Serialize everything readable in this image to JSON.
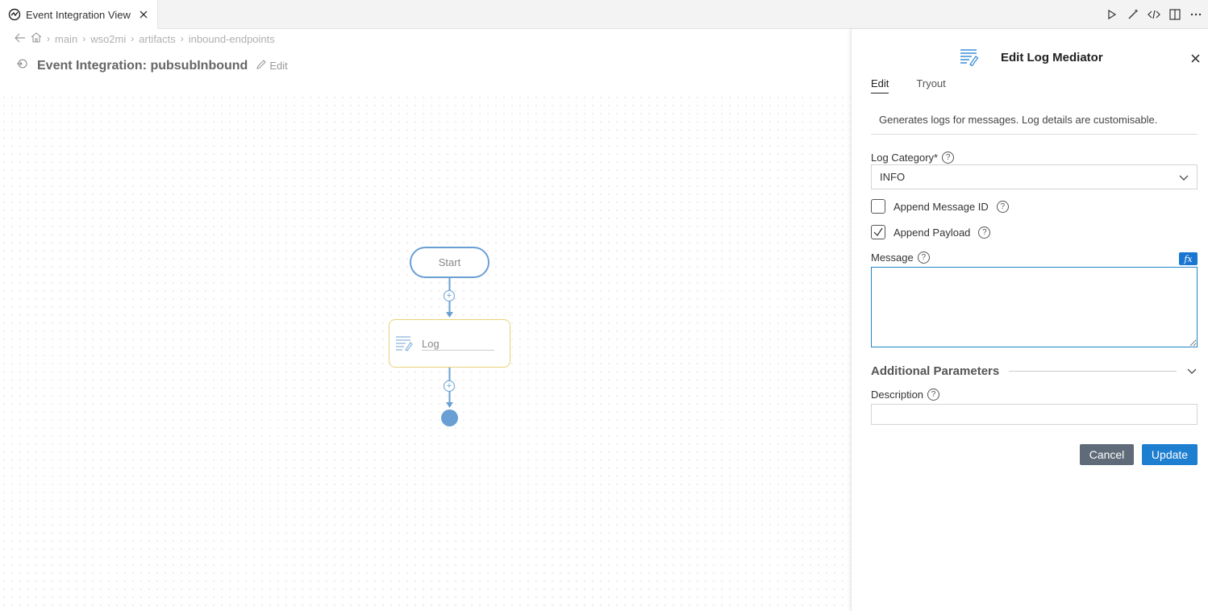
{
  "tab": {
    "title": "Event Integration View",
    "icon": "integration-icon"
  },
  "toolbar": {
    "icons": [
      "run-icon",
      "magic-wand-icon",
      "code-icon",
      "split-editor-icon",
      "more-icon"
    ]
  },
  "breadcrumb": {
    "items": [
      "main",
      "wso2mi",
      "artifacts",
      "inbound-endpoints"
    ]
  },
  "page": {
    "title": "Event Integration: pubsubInbound",
    "edit_label": "Edit"
  },
  "flow": {
    "start_label": "Start",
    "log_label": "Log"
  },
  "panel": {
    "title": "Edit Log Mediator",
    "tabs": [
      "Edit",
      "Tryout"
    ],
    "active_tab": "Edit",
    "description": "Generates logs for messages. Log details are customisable.",
    "log_category_label": "Log Category*",
    "log_category_value": "INFO",
    "append_message_id_label": "Append Message ID",
    "append_message_id_checked": false,
    "append_payload_label": "Append Payload",
    "append_payload_checked": true,
    "message_label": "Message",
    "fx_label": "fx",
    "message_value": "",
    "additional_params_label": "Additional Parameters",
    "description_label": "Description",
    "description_value": "",
    "cancel_label": "Cancel",
    "update_label": "Update"
  },
  "colors": {
    "accent": "#1e7ed0",
    "node_border": "#6a9fd4",
    "log_border": "#e8d27a",
    "cancel_bg": "#5f6b78"
  }
}
